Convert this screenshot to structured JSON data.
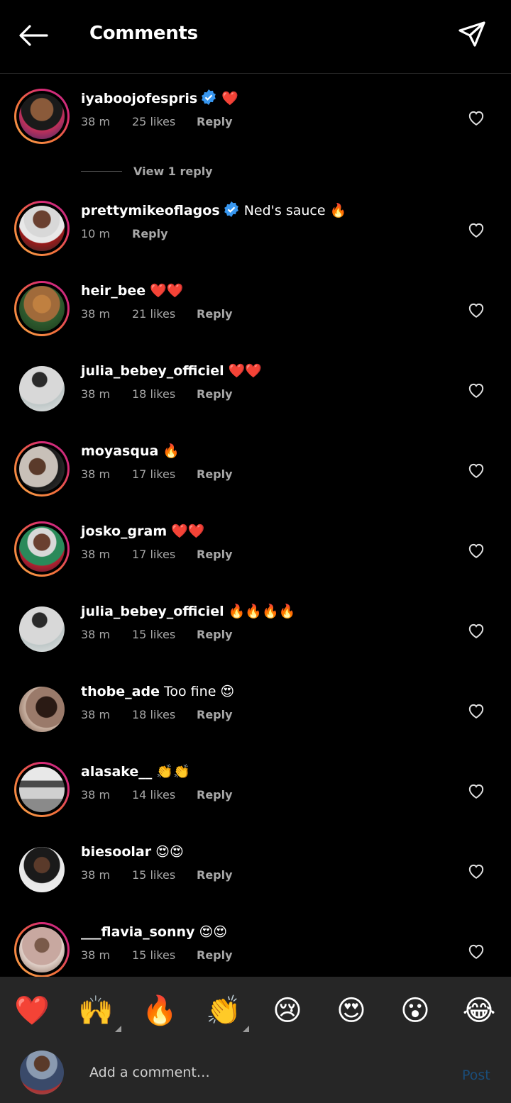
{
  "header": {
    "title": "Comments"
  },
  "comments": [
    {
      "user": "iyaboojofespris",
      "verified": true,
      "body": "❤️",
      "time": "38 m",
      "likes": "25 likes",
      "reply": "Reply"
    },
    {
      "user": "prettymikeoflagos",
      "verified": true,
      "body": "Ned's sauce 🔥",
      "time": "10 m",
      "likes": "",
      "reply": "Reply"
    },
    {
      "user": "heir_bee",
      "verified": false,
      "body": "❤️❤️",
      "time": "38 m",
      "likes": "21 likes",
      "reply": "Reply"
    },
    {
      "user": "julia_bebey_officiel",
      "verified": false,
      "body": "❤️❤️",
      "time": "38 m",
      "likes": "18 likes",
      "reply": "Reply"
    },
    {
      "user": "moyasqua",
      "verified": false,
      "body": "🔥",
      "time": "38 m",
      "likes": "17 likes",
      "reply": "Reply"
    },
    {
      "user": "josko_gram",
      "verified": false,
      "body": "❤️❤️",
      "time": "38 m",
      "likes": "17 likes",
      "reply": "Reply"
    },
    {
      "user": "julia_bebey_officiel",
      "verified": false,
      "body": "🔥🔥🔥🔥",
      "time": "38 m",
      "likes": "15 likes",
      "reply": "Reply"
    },
    {
      "user": "thobe_ade",
      "verified": false,
      "body": "Too fine 😍",
      "time": "38 m",
      "likes": "18 likes",
      "reply": "Reply"
    },
    {
      "user": "alasake__",
      "verified": false,
      "body": "👏👏",
      "time": "38 m",
      "likes": "14 likes",
      "reply": "Reply"
    },
    {
      "user": "biesoolar",
      "verified": false,
      "body": "😍😍",
      "time": "38 m",
      "likes": "15 likes",
      "reply": "Reply"
    },
    {
      "user": "___flavia_sonny",
      "verified": false,
      "body": "😍😍",
      "time": "38 m",
      "likes": "15 likes",
      "reply": "Reply"
    }
  ],
  "view_replies": "View 1 reply",
  "reactions": [
    "❤️",
    "🙌",
    "🔥",
    "👏",
    "😢",
    "😍",
    "😮",
    "😂"
  ],
  "input": {
    "placeholder": "Add a comment…",
    "post_label": "Post"
  },
  "colors": {
    "background": "#000000",
    "bar": "#262626",
    "muted": "#a8a8a8",
    "verified": "#3897f0",
    "post_disabled": "#1a4d7a"
  }
}
